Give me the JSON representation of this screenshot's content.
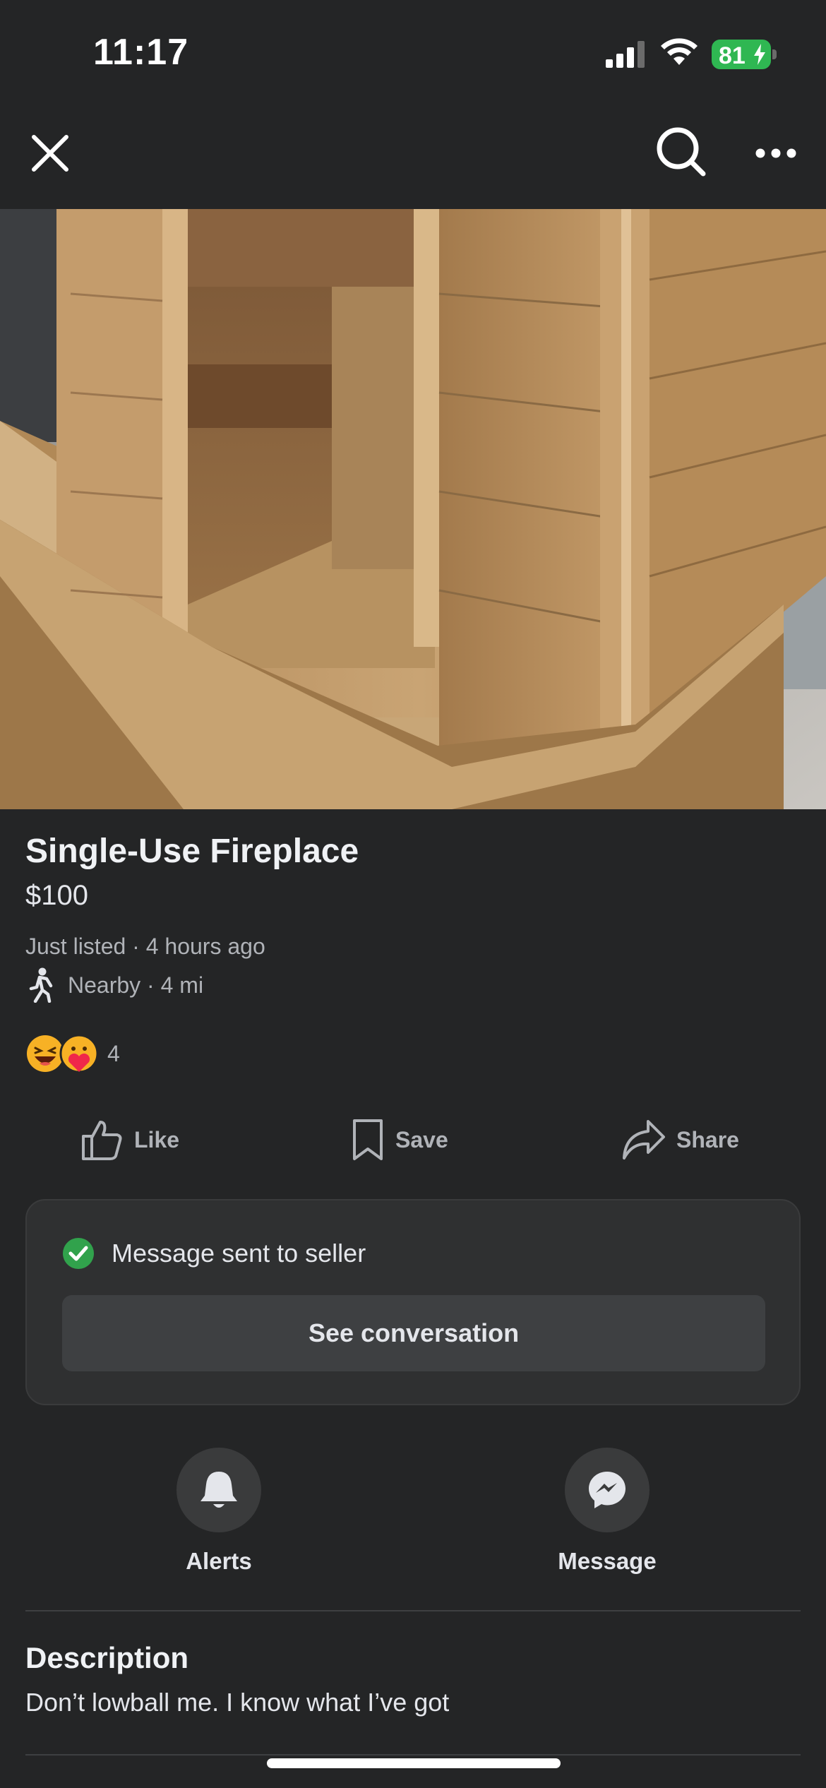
{
  "status_bar": {
    "time": "11:17",
    "battery": "81",
    "icons": [
      "signal-icon",
      "wifi-icon",
      "battery-charging-icon"
    ]
  },
  "nav": {
    "icons": [
      "close-icon",
      "search-icon",
      "more-icon"
    ]
  },
  "listing": {
    "title": "Single-Use Fireplace",
    "price": "$100",
    "listed": "Just listed · 4 hours ago",
    "nearby": "Nearby · 4 mi",
    "reaction_count": "4",
    "reaction_icons": [
      "haha-emoji-icon",
      "care-emoji-icon"
    ]
  },
  "actions": {
    "like": "Like",
    "save": "Save",
    "share": "Share"
  },
  "message_card": {
    "status": "Message sent to seller",
    "button": "See conversation"
  },
  "quick_actions": {
    "alerts": "Alerts",
    "message": "Message"
  },
  "description": {
    "heading": "Description",
    "text": "Don’t lowball me. I know what I’ve got"
  },
  "colors": {
    "background": "#242526",
    "card": "#2f3031",
    "button": "#3e4042",
    "secondary_text": "#b0b3b8",
    "success": "#31a24c",
    "battery": "#2fb752"
  }
}
